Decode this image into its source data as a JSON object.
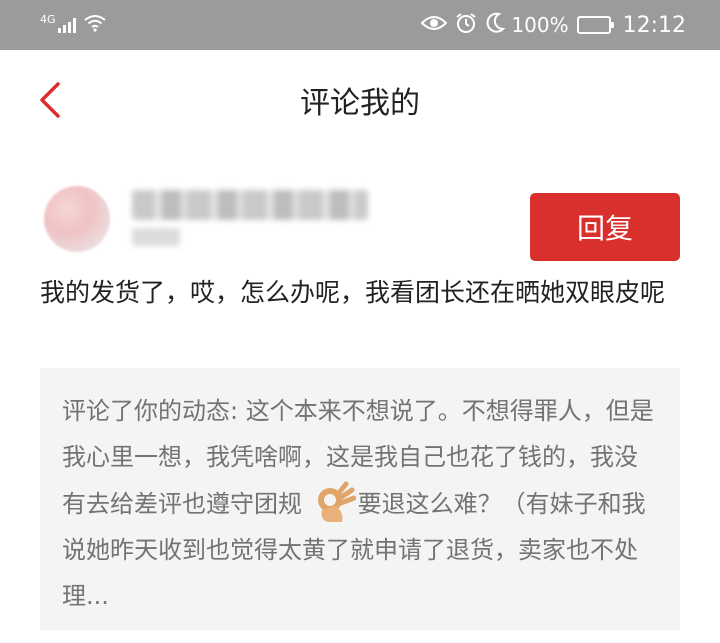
{
  "status_bar": {
    "network_type": "4G",
    "battery_percent": "100%",
    "battery_level": 1.0,
    "time": "12:12",
    "icons": [
      "signal-icon",
      "wifi-icon",
      "eye-icon",
      "alarm-icon",
      "moon-icon",
      "battery-icon"
    ]
  },
  "header": {
    "title": "评论我的",
    "back_icon": "chevron-left-icon"
  },
  "comment": {
    "reply_button_label": "回复",
    "text": "我的发货了，哎，怎么办呢，我看团长还在晒她双眼皮呢"
  },
  "quote": {
    "text_before_emoji": "评论了你的动态: 这个本来不想说了。不想得罪人，但是我心里一想，我凭啥啊，这是我自己也花了钱的，我没有去给差评也遵守团规",
    "emoji": "ok-hand-icon",
    "text_after_emoji": "要退这么难？（有妹子和我说她昨天收到也觉得太黄了就申请了退货，卖家也不处理..."
  },
  "colors": {
    "accent": "#d9302d",
    "status_bar": "#9b9b9b",
    "quote_bg": "#f4f4f4"
  }
}
